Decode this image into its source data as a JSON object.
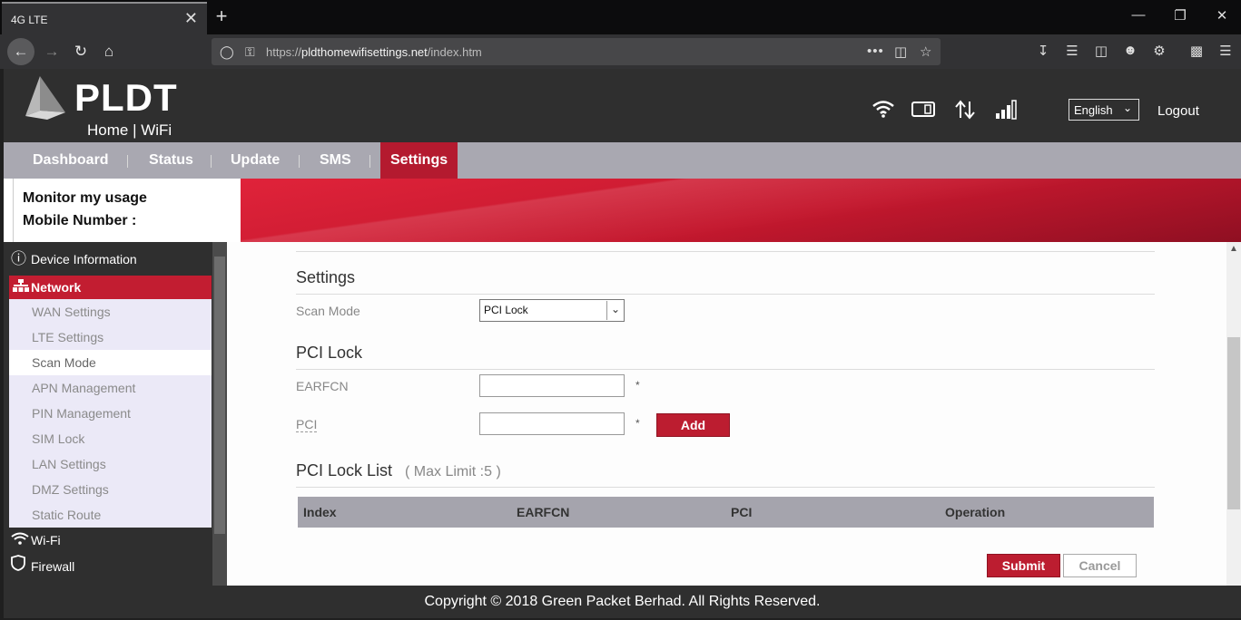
{
  "browser": {
    "tab_title": "4G LTE",
    "tab_close": "✕",
    "new_tab": "+",
    "url_prefix": "https://",
    "url_host": "pldthomewifisettings.net",
    "url_path": "/index.htm",
    "url_more": "•••"
  },
  "header": {
    "brand": "PLDT",
    "brand_sub": "Home | WiFi",
    "language": "English",
    "logout": "Logout"
  },
  "menu": {
    "items": [
      "Dashboard",
      "Status",
      "Update",
      "SMS",
      "Settings"
    ],
    "active": "Settings"
  },
  "usage": {
    "monitor": "Monitor my usage",
    "mobile_number": "Mobile Number :"
  },
  "sidebar": {
    "device_info": "Device Information",
    "network": "Network",
    "network_items": [
      "WAN Settings",
      "LTE Settings",
      "Scan Mode",
      "APN Management",
      "PIN Management",
      "SIM Lock",
      "LAN Settings",
      "DMZ Settings",
      "Static Route"
    ],
    "active_item": "Scan Mode",
    "wifi": "Wi-Fi",
    "firewall": "Firewall"
  },
  "content": {
    "settings_title": "Settings",
    "scan_mode_label": "Scan Mode",
    "scan_mode_value": "PCI Lock",
    "pci_lock_title": "PCI Lock",
    "earfcn_label": "EARFCN",
    "pci_label": "PCI",
    "required_mark": "*",
    "add_button": "Add",
    "pci_lock_list_title": "PCI Lock List",
    "max_limit": "( Max Limit :5 )",
    "table_headers": [
      "Index",
      "EARFCN",
      "PCI",
      "Operation"
    ],
    "submit_button": "Submit",
    "cancel_button": "Cancel"
  },
  "footer": {
    "copyright": "Copyright © 2018 Green Packet Berhad. All Rights Reserved."
  },
  "colors": {
    "brand_red": "#bc1d30",
    "header_dark": "#2f2f2f",
    "menu_grey": "#a9a8b1"
  }
}
